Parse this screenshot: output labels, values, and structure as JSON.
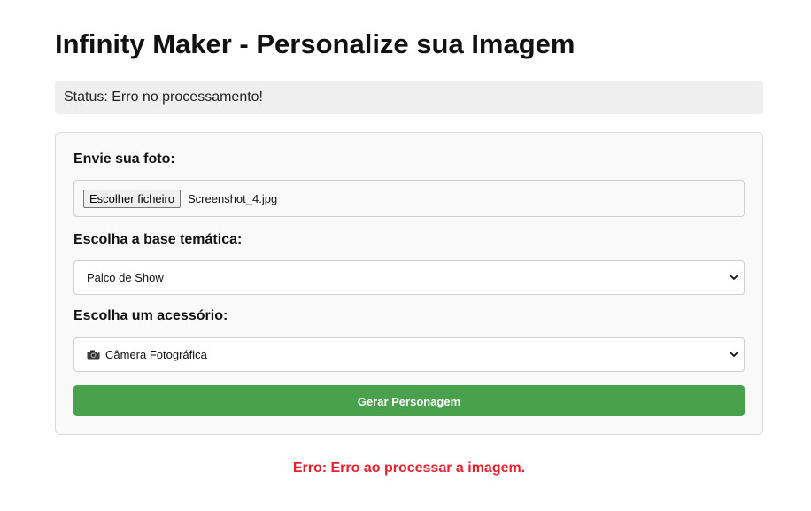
{
  "page": {
    "title": "Infinity Maker - Personalize sua Imagem"
  },
  "status": {
    "text": "Status: Erro no processamento!"
  },
  "form": {
    "photo_label": "Envie sua foto:",
    "file_button_label": "Escolher ficheiro",
    "file_name": "Screenshot_4.jpg",
    "theme_label": "Escolha a base temática:",
    "theme_selected": "Palco de Show",
    "accessory_label": "Escolha um acessório:",
    "accessory_selected": "Câmera Fotográfica",
    "accessory_icon": "camera-icon",
    "submit_label": "Gerar Personagem"
  },
  "error": {
    "text": "Erro: Erro ao processar a imagem."
  },
  "colors": {
    "button_green": "#4aa14d",
    "error_red": "#e8202e",
    "status_background": "#efefef",
    "card_background": "#f9f9f9"
  }
}
